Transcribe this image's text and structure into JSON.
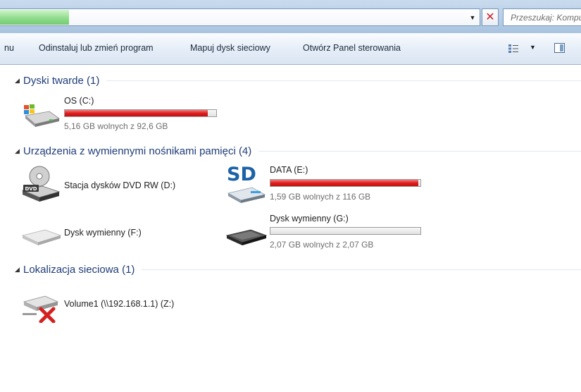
{
  "address_bar": {
    "search_placeholder": "Przeszukaj: Komputer",
    "dropdown_icon": "chevron-down-icon",
    "clear_icon": "close-icon"
  },
  "command_bar": {
    "menu_fragment": "nu",
    "uninstall": "Odinstaluj lub zmień program",
    "map_drive": "Mapuj dysk sieciowy",
    "control_panel": "Otwórz Panel sterowania"
  },
  "groups": {
    "hard_drives": {
      "title": "Dyski twarde (1)"
    },
    "removable": {
      "title": "Urządzenia z wymiennymi nośnikami pamięci (4)"
    },
    "network": {
      "title": "Lokalizacja sieciowa (1)"
    }
  },
  "drives": {
    "c": {
      "name": "OS (C:)",
      "free": "5,16 GB wolnych z 92,6 GB",
      "used_fraction": 0.944,
      "icon": "windows-hard-drive-icon"
    },
    "d": {
      "name": "Stacja dysków DVD RW (D:)",
      "icon": "dvd-drive-icon"
    },
    "e": {
      "name": "DATA (E:)",
      "free": "1,59 GB wolnych z 116 GB",
      "used_fraction": 0.986,
      "icon": "sd-card-icon"
    },
    "f": {
      "name": "Dysk wymienny (F:)",
      "icon": "removable-drive-icon"
    },
    "g": {
      "name": "Dysk wymienny (G:)",
      "free": "2,07 GB wolnych z 2,07 GB",
      "used_fraction": 0.0,
      "icon": "removable-drive-icon"
    },
    "z": {
      "name": "Volume1 (\\\\192.168.1.1) (Z:)",
      "icon": "disconnected-network-drive-icon"
    }
  },
  "colors": {
    "bar_used": "#de1f1f",
    "group_title": "#1e3c78",
    "disconnected_x": "#d42020",
    "sd_logo": "#1d62a8"
  }
}
